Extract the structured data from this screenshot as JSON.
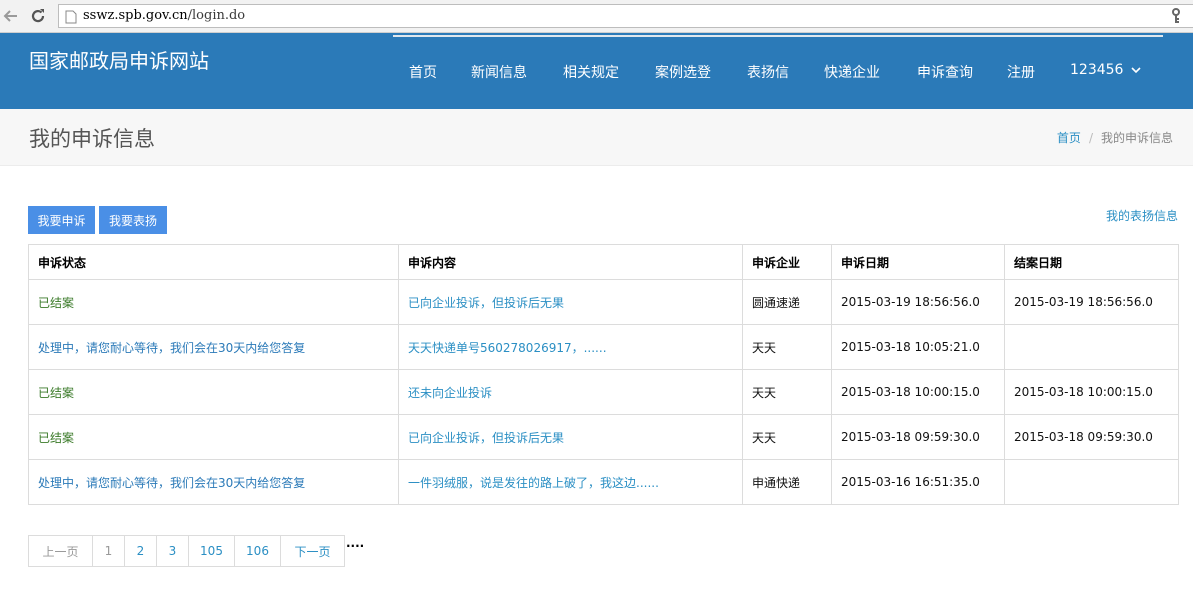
{
  "browser": {
    "url_domain": "sswz.spb.gov.cn",
    "url_path": "/login.do"
  },
  "header": {
    "site_title": "国家邮政局申诉网站",
    "nav": [
      "首页",
      "新闻信息",
      "相关规定",
      "案例选登",
      "表扬信",
      "快递企业",
      "申诉查询",
      "注册"
    ],
    "user": "123456"
  },
  "title_band": {
    "title": "我的申诉信息",
    "breadcrumb_home": "首页",
    "breadcrumb_sep": "/",
    "breadcrumb_current": "我的申诉信息"
  },
  "actions": {
    "complain": "我要申诉",
    "praise": "我要表扬",
    "my_praise_link": "我的表扬信息"
  },
  "table": {
    "headers": [
      "申诉状态",
      "申诉内容",
      "申诉企业",
      "申诉日期",
      "结案日期"
    ],
    "rows": [
      {
        "status": "已结案",
        "content": "已向企业投诉，但投诉后无果",
        "company": "圆通速递",
        "date": "2015-03-19 18:56:56.0",
        "close": "2015-03-19 18:56:56.0"
      },
      {
        "status": "处理中，请您耐心等待，我们会在30天内给您答复",
        "content": "天天快递单号560278026917，......",
        "company": "天天",
        "date": "2015-03-18 10:05:21.0",
        "close": ""
      },
      {
        "status": "已结案",
        "content": "还未向企业投诉",
        "company": "天天",
        "date": "2015-03-18 10:00:15.0",
        "close": "2015-03-18 10:00:15.0"
      },
      {
        "status": "已结案",
        "content": "已向企业投诉，但投诉后无果",
        "company": "天天",
        "date": "2015-03-18 09:59:30.0",
        "close": "2015-03-18 09:59:30.0"
      },
      {
        "status": "处理中，请您耐心等待，我们会在30天内给您答复",
        "content": "一件羽绒服，说是发往的路上破了，我这边......",
        "company": "申通快递",
        "date": "2015-03-16 16:51:35.0",
        "close": ""
      }
    ]
  },
  "pagination": {
    "prev": "上一页",
    "pages": [
      "1",
      "2",
      "3",
      "105",
      "106"
    ],
    "next": "下一页",
    "ellipsis": "...."
  }
}
